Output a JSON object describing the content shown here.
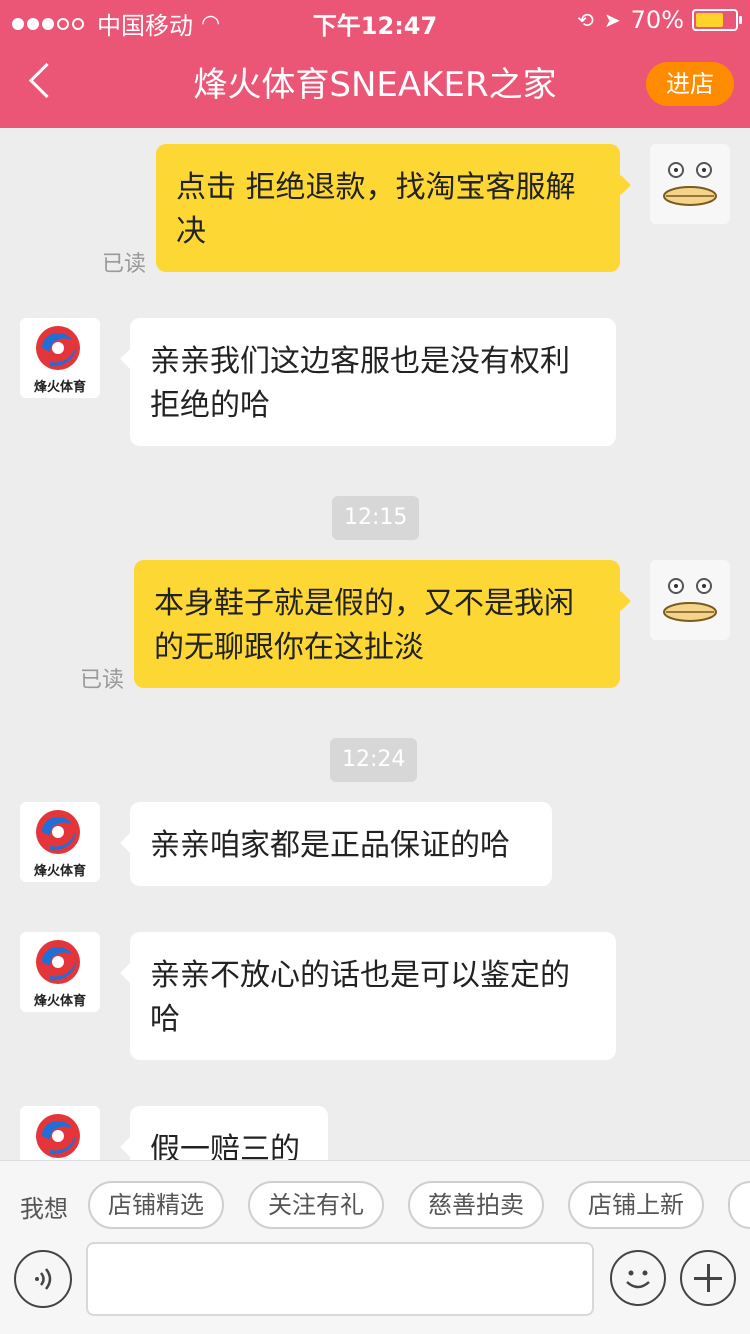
{
  "status": {
    "carrier": "中国移动",
    "time": "下午12:47",
    "battery_text": "70%",
    "battery_level": 0.7
  },
  "header": {
    "title": "烽火体育SNEAKER之家",
    "enter_label": "进店"
  },
  "messages": [
    {
      "side": "right",
      "text": "点击 拒绝退款，找淘宝客服解决",
      "status": "已读"
    },
    {
      "side": "left",
      "text": "亲亲我们这边客服也是没有权利拒绝的哈"
    },
    {
      "time": "12:15"
    },
    {
      "side": "right",
      "text": "本身鞋子就是假的，又不是我闲的无聊跟你在这扯淡",
      "status": "已读"
    },
    {
      "time": "12:24"
    },
    {
      "side": "left",
      "text": "亲亲咱家都是正品保证的哈"
    },
    {
      "side": "left",
      "text": "亲亲不放心的话也是可以鉴定的哈"
    },
    {
      "side": "left",
      "text": "假一赔三的"
    }
  ],
  "suggest": {
    "label": "我想",
    "pills": [
      "店铺精选",
      "关注有礼",
      "慈善拍卖",
      "店铺上新"
    ]
  },
  "shop_logo_text": "烽火体育"
}
